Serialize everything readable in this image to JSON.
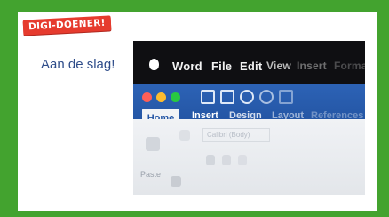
{
  "badge": {
    "label": "DIGI-DOENER!"
  },
  "heading": {
    "text": "Aan de slag!"
  },
  "hero": {
    "menu": [
      "Word",
      "File",
      "Edit",
      "View",
      "Insert",
      "Format"
    ],
    "tabs": [
      "Home",
      "Insert",
      "Design",
      "Layout",
      "References"
    ],
    "paste_label": "Paste",
    "font_box": "Calibri (Body)"
  },
  "colors": {
    "frame_green": "#43a32f",
    "badge_red": "#e63b2e",
    "heading_blue": "#2f4d8a",
    "word_blue": "#2456a5"
  }
}
